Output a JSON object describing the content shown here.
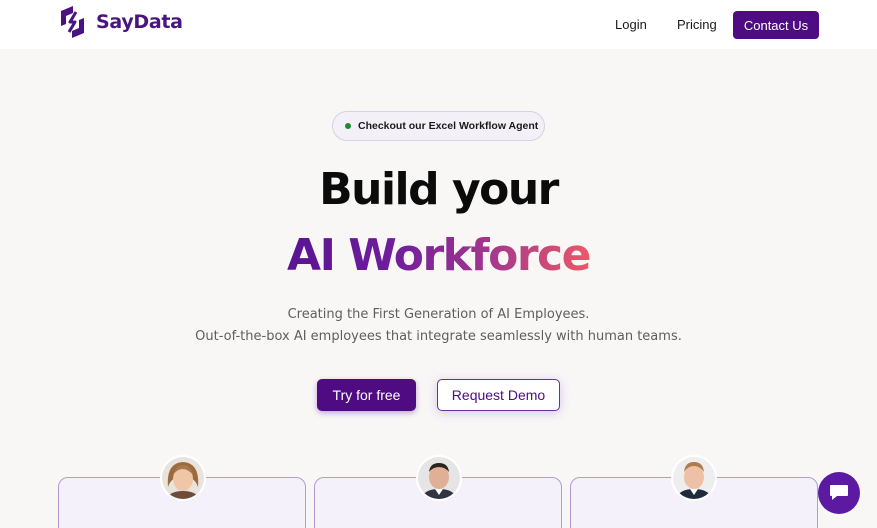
{
  "brand": {
    "name": "SayData",
    "color": "#4b1381"
  },
  "nav": {
    "login": "Login",
    "pricing": "Pricing",
    "contact": "Contact Us"
  },
  "hero": {
    "badge": "Checkout our Excel Workflow Agent",
    "title_line1": "Build your",
    "title_line2": "AI Workforce",
    "subtitle_line1": "Creating the First Generation of AI Employees.",
    "subtitle_line2": "Out-of-the-box AI employees that integrate seamlessly with human teams.",
    "primary_cta": "Try for free",
    "secondary_cta": "Request Demo"
  },
  "cards": [
    {
      "avatar": "woman-avatar"
    },
    {
      "avatar": "man-avatar"
    },
    {
      "avatar": "man-avatar"
    }
  ],
  "chat": {
    "icon": "chat-bubble-icon"
  },
  "colors": {
    "accent": "#4f0c82",
    "badge_dot": "#1f8a2d",
    "gradient_start": "#5a1391",
    "gradient_end": "#ec5867"
  }
}
